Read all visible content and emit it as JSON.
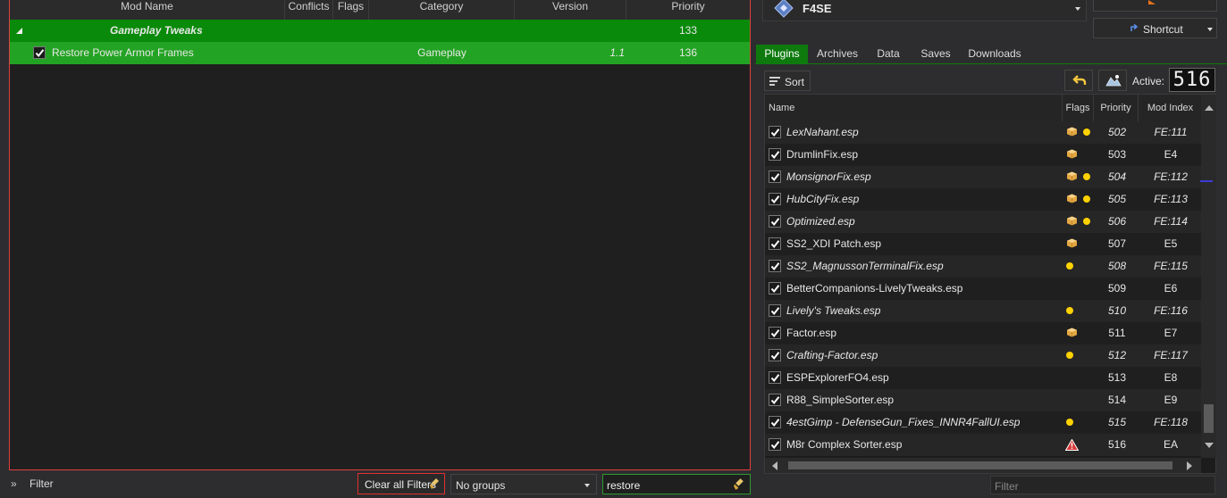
{
  "mod_list": {
    "headers": {
      "mod_name": "Mod Name",
      "conflicts": "Conflicts",
      "flags": "Flags",
      "category": "Category",
      "version": "Version",
      "priority": "Priority"
    },
    "group_row": {
      "name": "Gameplay Tweaks",
      "priority": "133"
    },
    "mod_row": {
      "name": "Restore Power Armor Frames",
      "category": "Gameplay",
      "version": "1.1",
      "priority": "136",
      "checked": true
    }
  },
  "bottom_bar": {
    "filter_label": "Filter",
    "clear_filters_label": "Clear all Filters",
    "groups_select": "No groups",
    "search_value": "restore"
  },
  "executable": {
    "name": "F4SE",
    "shortcut_label": "Shortcut"
  },
  "tabs": [
    "Plugins",
    "Archives",
    "Data",
    "Saves",
    "Downloads"
  ],
  "plugins_toolbar": {
    "sort_label": "Sort",
    "active_label": "Active:",
    "active_count": "516"
  },
  "plugin_headers": {
    "name": "Name",
    "flags": "Flags",
    "priority": "Priority",
    "mod_index": "Mod Index"
  },
  "plugins": [
    {
      "name": "LexNahant.esp",
      "priority": "502",
      "mod_index": "FE:111",
      "italic": true,
      "box": true,
      "dot": true,
      "warn": false
    },
    {
      "name": "DrumlinFix.esp",
      "priority": "503",
      "mod_index": "E4",
      "italic": false,
      "box": true,
      "dot": false,
      "warn": false
    },
    {
      "name": "MonsignorFix.esp",
      "priority": "504",
      "mod_index": "FE:112",
      "italic": true,
      "box": true,
      "dot": true,
      "warn": false
    },
    {
      "name": "HubCityFix.esp",
      "priority": "505",
      "mod_index": "FE:113",
      "italic": true,
      "box": true,
      "dot": true,
      "warn": false
    },
    {
      "name": "Optimized.esp",
      "priority": "506",
      "mod_index": "FE:114",
      "italic": true,
      "box": true,
      "dot": true,
      "warn": false
    },
    {
      "name": "SS2_XDI Patch.esp",
      "priority": "507",
      "mod_index": "E5",
      "italic": false,
      "box": true,
      "dot": false,
      "warn": false
    },
    {
      "name": "SS2_MagnussonTerminalFix.esp",
      "priority": "508",
      "mod_index": "FE:115",
      "italic": true,
      "box": false,
      "dot": true,
      "warn": false
    },
    {
      "name": "BetterCompanions-LivelyTweaks.esp",
      "priority": "509",
      "mod_index": "E6",
      "italic": false,
      "box": false,
      "dot": false,
      "warn": false
    },
    {
      "name": "Lively's Tweaks.esp",
      "priority": "510",
      "mod_index": "FE:116",
      "italic": true,
      "box": false,
      "dot": true,
      "warn": false
    },
    {
      "name": "Factor.esp",
      "priority": "511",
      "mod_index": "E7",
      "italic": false,
      "box": true,
      "dot": false,
      "warn": false
    },
    {
      "name": "Crafting-Factor.esp",
      "priority": "512",
      "mod_index": "FE:117",
      "italic": true,
      "box": false,
      "dot": true,
      "warn": false
    },
    {
      "name": "ESPExplorerFO4.esp",
      "priority": "513",
      "mod_index": "E8",
      "italic": false,
      "box": false,
      "dot": false,
      "warn": false
    },
    {
      "name": "R88_SimpleSorter.esp",
      "priority": "514",
      "mod_index": "E9",
      "italic": false,
      "box": false,
      "dot": false,
      "warn": false
    },
    {
      "name": "4estGimp - DefenseGun_Fixes_INNR4FallUI.esp",
      "priority": "515",
      "mod_index": "FE:118",
      "italic": true,
      "box": false,
      "dot": true,
      "warn": false
    },
    {
      "name": "M8r Complex Sorter.esp",
      "priority": "516",
      "mod_index": "EA",
      "italic": false,
      "box": false,
      "dot": false,
      "warn": true
    }
  ],
  "plugin_filter_placeholder": "Filter",
  "colors": {
    "group_row": "#0a8a0a",
    "selected_row": "#23a323",
    "active_tab": "#0e7a0e",
    "filter_highlight": "#e03030",
    "flag_dot": "#ffd200"
  }
}
